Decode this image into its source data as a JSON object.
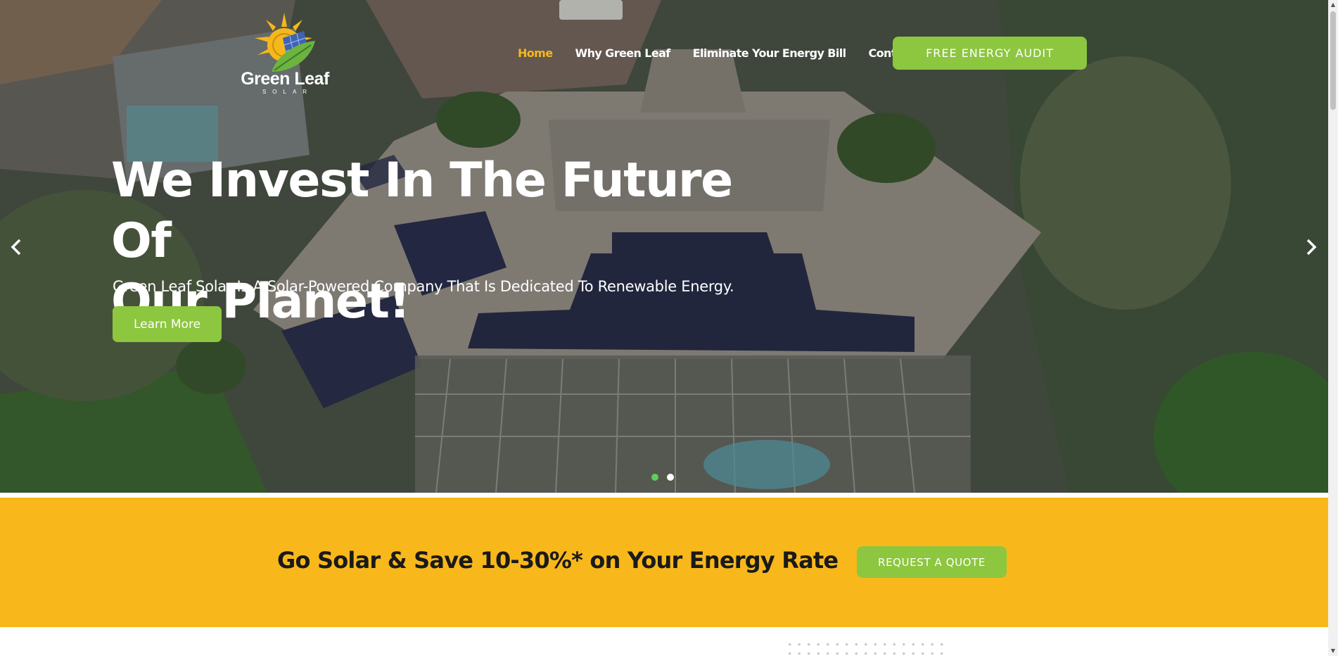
{
  "brand": {
    "name": "Green Leaf",
    "tagline": "SOLAR",
    "colors": {
      "green": "#8dc63f",
      "yellow": "#f8b81b",
      "nav_active": "#f4b81d",
      "dot_active": "#5fcf5c"
    }
  },
  "nav": {
    "items": [
      {
        "label": "Home",
        "active": true
      },
      {
        "label": "Why Green Leaf",
        "active": false
      },
      {
        "label": "Eliminate Your Energy Bill",
        "active": false
      },
      {
        "label": "Contact",
        "active": false
      }
    ],
    "cta_label": "FREE ENERGY AUDIT"
  },
  "hero": {
    "title_line1": "We Invest In The Future Of",
    "title_line2": "Our Planet!",
    "subtitle": "Green Leaf Solar Is A Solar-Powered Company That Is Dedicated To Renewable Energy.",
    "button_label": "Learn More",
    "prev_icon": "chevron-left-icon",
    "next_icon": "chevron-right-icon",
    "slides_total": 2,
    "active_slide": 1
  },
  "banner": {
    "text": "Go Solar & Save 10-30%* on Your Energy Rate",
    "button_label": "REQUEST A QUOTE"
  }
}
